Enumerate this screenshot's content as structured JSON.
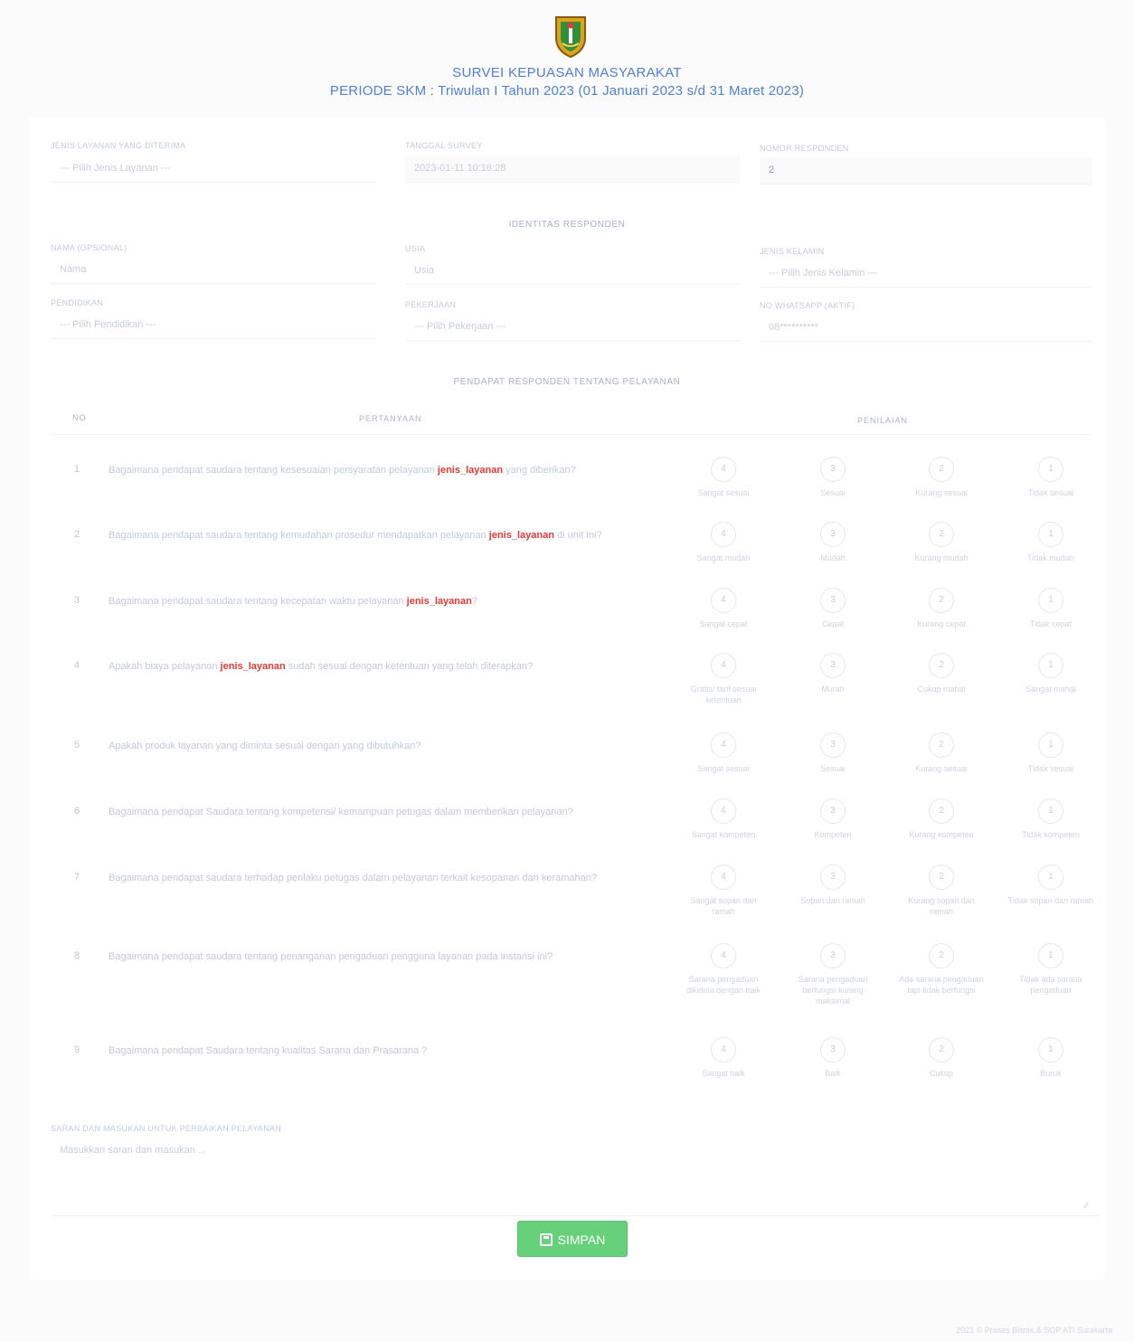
{
  "header": {
    "title": "SURVEI KEPUASAN MASYARAKAT",
    "period": "PERIODE SKM : Triwulan I Tahun 2023 (01 Januari 2023 s/d 31 Maret 2023)",
    "logo_icon": "regional-emblem-icon"
  },
  "fields": {
    "jenis_layanan": {
      "label": "JENIS LAYANAN YANG DITERIMA",
      "placeholder": "--- Pilih Jenis Layanan ---"
    },
    "tanggal_survey": {
      "label": "TANGGAL SURVEY",
      "value": "2023-01-11 10:16:28"
    },
    "nomor_responden": {
      "label": "NOMOR RESPONDEN",
      "value": "2"
    }
  },
  "identitas": {
    "title": "IDENTITAS RESPONDEN",
    "nama": {
      "label": "NAMA (OPSIONAL)",
      "placeholder": "Nama"
    },
    "usia": {
      "label": "USIA",
      "placeholder": "Usia"
    },
    "jenis_kelamin": {
      "label": "JENIS KELAMIN",
      "placeholder": "--- Pilih Jenis Kelamin ---"
    },
    "pendidikan": {
      "label": "PENDIDIKAN",
      "placeholder": "--- Pilih Pendidikan ---"
    },
    "pekerjaan": {
      "label": "PEKERJAAN",
      "placeholder": "--- Pilih Pekerjaan ---"
    },
    "whatsapp": {
      "label": "NO WHATSAPP (AKTIF)",
      "placeholder": "08**********"
    }
  },
  "pendapat": {
    "title": "PENDAPAT RESPONDEN TENTANG PELAYANAN",
    "col_no": "NO",
    "col_pertanyaan": "PERTANYAAN",
    "col_penilaian": "PENILAIAN",
    "questions": [
      {
        "no": "1",
        "pre": "Bagaimana pendapat saudara tentang kesesuaian persyaratan pelayanan ",
        "hl": "jenis_layanan",
        "post": " yang diberikan?",
        "options": [
          "Sangat sesuai",
          "Sesuai",
          "Kurang sesuai",
          "Tidak sesuai"
        ]
      },
      {
        "no": "2",
        "pre": "Bagaimana pendapat saudara tentang kemudahan prosedur mendapatkan pelayanan ",
        "hl": "jenis_layanan",
        "post": " di unit ini?",
        "options": [
          "Sangat mudah",
          "Mudah",
          "Kurang mudah",
          "Tidak mudah"
        ]
      },
      {
        "no": "3",
        "pre": "Bagaimana pendapat saudara tentang kecepatan waktu pelayanan ",
        "hl": "jenis_layanan",
        "post": "?",
        "options": [
          "Sangat cepat",
          "Cepat",
          "Kurang cepat",
          "Tidak cepat"
        ]
      },
      {
        "no": "4",
        "pre": "Apakah biaya pelayanan ",
        "hl": "jenis_layanan",
        "post": " sudah sesuai dengan ketentuan yang telah diterapkan?",
        "options": [
          "Gratis/ tarif sesuai ketentuan",
          "Murah",
          "Cukup mahal",
          "Sangat mahal"
        ]
      },
      {
        "no": "5",
        "pre": "Apakah produk layanan yang diminta sesuai dengan yang dibutuhkan?",
        "hl": "",
        "post": "",
        "options": [
          "Sangat sesuai",
          "Sesuai",
          "Kurang sesuai",
          "Tidak sesuai"
        ]
      },
      {
        "no": "6",
        "pre": "Bagaimana pendapat Saudara tentang kompetensi/ kemampuan petugas dalam memberikan pelayanan?",
        "hl": "",
        "post": "",
        "options": [
          "Sangat kompeten",
          "Kompeten",
          "Kurang kompeten",
          "Tidak kompeten"
        ]
      },
      {
        "no": "7",
        "pre": "Bagaimana pendapat saudara terhadap perilaku petugas dalam pelayanan terkait kesopanan dan keramahan?",
        "hl": "",
        "post": "",
        "options": [
          "Sangat sopan dan ramah",
          "Sopan dan ramah",
          "Kurang sopan dan ramah",
          "Tidak sopan dan ramah"
        ]
      },
      {
        "no": "8",
        "pre": "Bagaimana pendapat saudara tentang penanganan pengaduan pengguna layanan pada instansi ini?",
        "hl": "",
        "post": "",
        "options": [
          "Sarana pengaduan dikelola dengan baik",
          "Sarana pengaduan berfungsi kurang maksimal",
          "Ada sarana pengaduan tapi tidak berfungsi",
          "Tidak ada sarana pengaduan"
        ]
      },
      {
        "no": "9",
        "pre": "Bagaimana pendapat Saudara tentang kualitas Sarana dan Prasarana ?",
        "hl": "",
        "post": "",
        "options": [
          "Sangat baik",
          "Baik",
          "Cukup",
          "Buruk"
        ]
      }
    ],
    "scores": [
      "4",
      "3",
      "2",
      "1"
    ]
  },
  "saran": {
    "label": "SARAN DAN MASUKAN UNTUK PERBAIKAN PELAYANAN",
    "placeholder": "Masukkan saran dan masukan ..."
  },
  "submit": {
    "label": "SIMPAN",
    "icon": "save-icon"
  },
  "footer": {
    "text": "2021 © Proses Bisnis & SOP ATI Surakarta"
  },
  "colors": {
    "primary_text": "#4f7fd6",
    "highlight": "#e53935",
    "button": "#66d17a"
  }
}
